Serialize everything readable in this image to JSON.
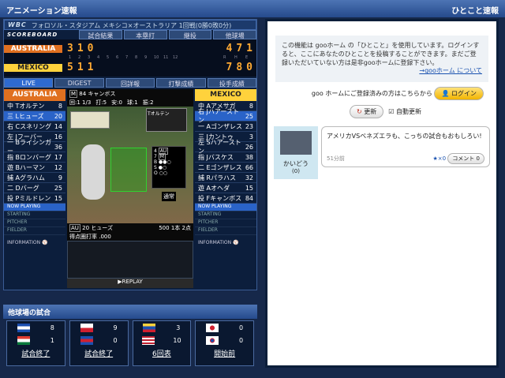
{
  "header": {
    "left_title": "アニメーション速報",
    "right_title": "ひとこと速報"
  },
  "match": {
    "league": "WBC",
    "venue": "フォロソル・スタジアム メキシコ×オーストラリア 1回戦(0勝0敗0分)",
    "scoreboard_label": "SCOREBOARD",
    "tabs": [
      "試合結果",
      "本塁打",
      "継投",
      "他球場"
    ],
    "innings": [
      "1",
      "2",
      "3",
      "4",
      "5",
      "6",
      "7",
      "8",
      "9",
      "10",
      "11",
      "12"
    ],
    "rhe": [
      "R",
      "H",
      "E"
    ],
    "teams": [
      {
        "name": "AUSTRALIA",
        "innings": [
          "3",
          "1",
          "0"
        ],
        "r": "4",
        "h": "7",
        "e": "1"
      },
      {
        "name": "MEXICO",
        "innings": [
          "5",
          "1",
          "1"
        ],
        "r": "7",
        "h": "8",
        "e": "0"
      }
    ]
  },
  "view_tabs": [
    "LIVE",
    "DIGEST",
    "回詳報",
    "打撃成績",
    "投手成績"
  ],
  "away_roster": {
    "team": "AUSTRALIA",
    "players": [
      {
        "pos": "中",
        "name": "Tオルテン",
        "num": "8"
      },
      {
        "pos": "三",
        "name": "Lヒューズ",
        "num": "20"
      },
      {
        "pos": "右",
        "name": "Cスネリング",
        "num": "14"
      },
      {
        "pos": "左",
        "name": "Jフーバー",
        "num": "16"
      },
      {
        "pos": "一",
        "name": "Bライシンガー",
        "num": "36"
      },
      {
        "pos": "指",
        "name": "Bロンバーグ",
        "num": "17"
      },
      {
        "pos": "遊",
        "name": "Bハーマン",
        "num": "12"
      },
      {
        "pos": "捕",
        "name": "Aグラハム",
        "num": "9"
      },
      {
        "pos": "二",
        "name": "Dバーグ",
        "num": "25"
      },
      {
        "pos": "投",
        "name": "Pミルドレン",
        "num": "15"
      }
    ]
  },
  "home_roster": {
    "team": "MEXICO",
    "players": [
      {
        "pos": "中",
        "name": "Aアメサガ",
        "num": "8"
      },
      {
        "pos": "右",
        "name": "Jハアーストン",
        "num": "25"
      },
      {
        "pos": "一",
        "name": "Aゴンザレス",
        "num": "23"
      },
      {
        "pos": "三",
        "name": "Jカントゥ",
        "num": "3"
      },
      {
        "pos": "左",
        "name": "Sハアーストン",
        "num": "26"
      },
      {
        "pos": "指",
        "name": "Jバスケス",
        "num": "38"
      },
      {
        "pos": "二",
        "name": "Eゴンザレス",
        "num": "66"
      },
      {
        "pos": "捕",
        "name": "Rパラハス",
        "num": "32"
      },
      {
        "pos": "遊",
        "name": "Aオヘダ",
        "num": "15"
      },
      {
        "pos": "投",
        "name": "Fキャンボス",
        "num": "84"
      }
    ]
  },
  "status_rows": [
    "NOW PLAYING",
    "STARTING",
    "PITCHER",
    "FIELDER"
  ],
  "information_label": "INFORMATION",
  "live": {
    "pitcher_tag": "M",
    "pitcher_num": "84",
    "pitcher": "キャンボス",
    "inning": "回:1 1/3",
    "pitches": "打:5",
    "hits": "安:0",
    "walks": "球:1",
    "k": "振:2",
    "runner": "Tオルテン",
    "count": {
      "score_a": "4",
      "score_m": "7",
      "tag_a": "AU",
      "tag_m": "M",
      "b": "B",
      "s": "S",
      "o": "O"
    },
    "normal": "通常",
    "batter_tag": "AU",
    "batter_num": "20",
    "batter": "ヒューズ",
    "avg": "500",
    "hr": "1本",
    "rbi": "2点",
    "risp": "得点圏打率 .000",
    "replay": "▶REPLAY"
  },
  "other_games": {
    "title": "他球場の試合",
    "games": [
      {
        "top": "8",
        "bottom": "1",
        "status": "試合終了"
      },
      {
        "top": "9",
        "bottom": "0",
        "status": "試合終了"
      },
      {
        "top": "3",
        "bottom": "10",
        "status": "6回表"
      },
      {
        "top": "0",
        "bottom": "0",
        "status": "開始前"
      }
    ]
  },
  "hitokoto": {
    "notice": "この機能は gooホーム の「ひとこと」を使用しています。ログインすると、ここにあなたのひとことを投稿することができます。まだご登録いただいていない方は是非gooホームに登録下さい。",
    "about_link": "→gooホーム について",
    "login_prompt": "goo ホームにご登録済みの方はこちらから",
    "login": "ログイン",
    "refresh": "更新",
    "auto": "自動更新",
    "post": {
      "user": "かいどう",
      "count": "(0)",
      "text": "アメリカVSベネズエラも、こっちの試合もおもしろい!",
      "time": "51分前",
      "stars": "★×0",
      "comment": "コメント 0"
    }
  }
}
